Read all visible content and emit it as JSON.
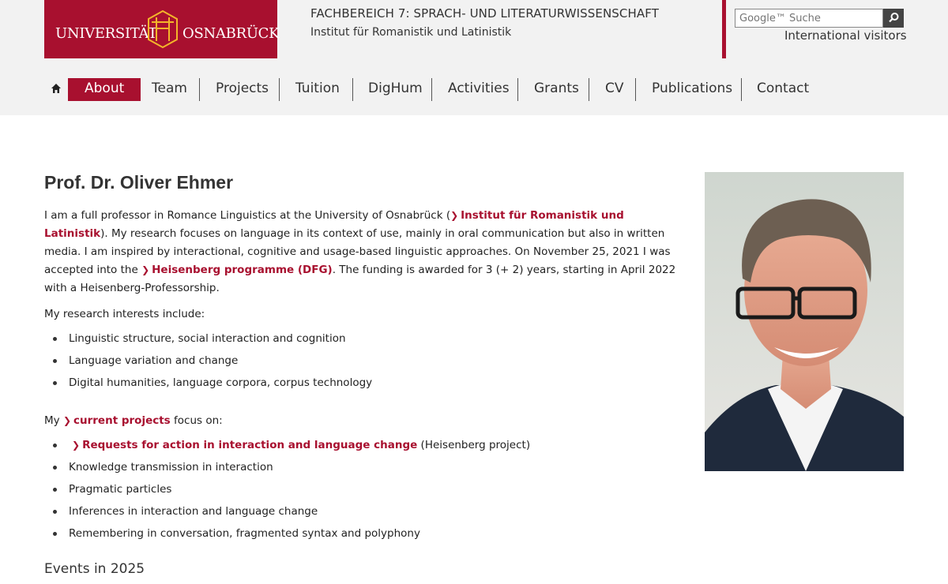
{
  "header": {
    "logo_left": "UNIVERSITÄT",
    "logo_right": "OSNABRÜCK",
    "department": "FACHBEREICH 7: SPRACH- UND LITERATURWISSENSCHAFT",
    "institute": "Institut für Romanistik und Latinistik",
    "search_placeholder": "Google™ Suche",
    "international": "International visitors"
  },
  "nav": {
    "items": [
      {
        "label": "About",
        "active": true
      },
      {
        "label": "Team"
      },
      {
        "label": "Projects"
      },
      {
        "label": "Tuition"
      },
      {
        "label": "DigHum"
      },
      {
        "label": "Activities"
      },
      {
        "label": "Grants"
      },
      {
        "label": "CV"
      },
      {
        "label": "Publications"
      },
      {
        "label": "Contact"
      }
    ]
  },
  "content": {
    "title": "Prof. Dr. Oliver Ehmer",
    "intro_1": "I am a full professor in Romance Linguistics at the University of Osnabrück (",
    "intro_link_1": "Institut für Romanistik und Latinistik",
    "intro_2": "). My research focuses on language in its context of use, mainly in oral communication but also in written media. I am inspired by interactional, cognitive and usage-based linguistic approaches. On November 25, 2021 I was accepted into the ",
    "intro_link_2": "Heisenberg programme (DFG)",
    "intro_3": ". The funding is awarded for 3 (+ 2) years, starting in April 2022 with a Heisenberg-Professorship.",
    "interests_head": "My research interests include:",
    "interests": [
      "Linguistic structure, social interaction and cognition",
      "Language variation and change",
      "Digital humanities, language corpora, corpus technology"
    ],
    "projects_prefix": "My ",
    "projects_link": "current projects",
    "projects_suffix": " focus on:",
    "project_first_link": "Requests for action in interaction and language change",
    "project_first_suffix": " (Heisenberg project)",
    "projects": [
      "Knowledge transmission in interaction",
      "Pragmatic particles",
      "Inferences in interaction and language change",
      "Remembering in conversation, fragmented syntax and polyphony"
    ],
    "events_head": "Events in 2025"
  },
  "colors": {
    "brand": "#a8102f",
    "header_bg": "#f2f2f2"
  },
  "icons": [
    "home-icon",
    "search-icon",
    "chevron-right-icon"
  ]
}
